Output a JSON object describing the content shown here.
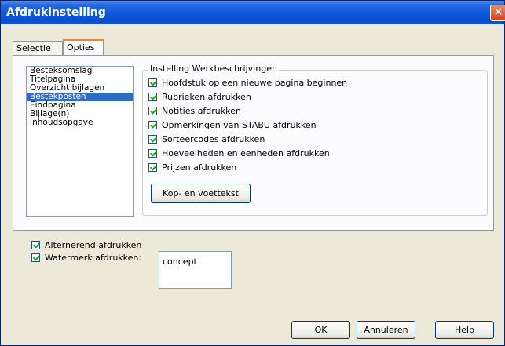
{
  "window": {
    "title": "Afdrukinstelling",
    "close_symbol": "✕"
  },
  "tabs": [
    {
      "label": "Selectie"
    },
    {
      "label": "Opties"
    }
  ],
  "list": {
    "items": [
      "Besteksomslag",
      "Titelpagina",
      "Overzicht bijlagen",
      "Bestekposten",
      "Eindpagina",
      "Bijlage(n)",
      "Inhoudsopgave"
    ],
    "selected": "Bestekposten"
  },
  "group": {
    "legend": "Instelling Werkbeschrijvingen",
    "options": [
      {
        "label": "Hoofdstuk op een nieuwe pagina beginnen",
        "checked": true
      },
      {
        "label": "Rubrieken afdrukken",
        "checked": true
      },
      {
        "label": "Notities afdrukken",
        "checked": true
      },
      {
        "label": "Opmerkingen van STABU afdrukken",
        "checked": true
      },
      {
        "label": "Sorteercodes afdrukken",
        "checked": true
      },
      {
        "label": "Hoeveelheden en eenheden afdrukken",
        "checked": true
      },
      {
        "label": "Prijzen afdrukken",
        "checked": true
      }
    ],
    "button_label": "Kop- en voettekst"
  },
  "bottom_options": [
    {
      "label": "Alternerend afdrukken",
      "checked": true
    },
    {
      "label": "Watermerk afdrukken:",
      "checked": true
    }
  ],
  "watermark": {
    "value": "concept"
  },
  "buttons": {
    "ok": "OK",
    "cancel": "Annuleren",
    "help": "Help"
  }
}
